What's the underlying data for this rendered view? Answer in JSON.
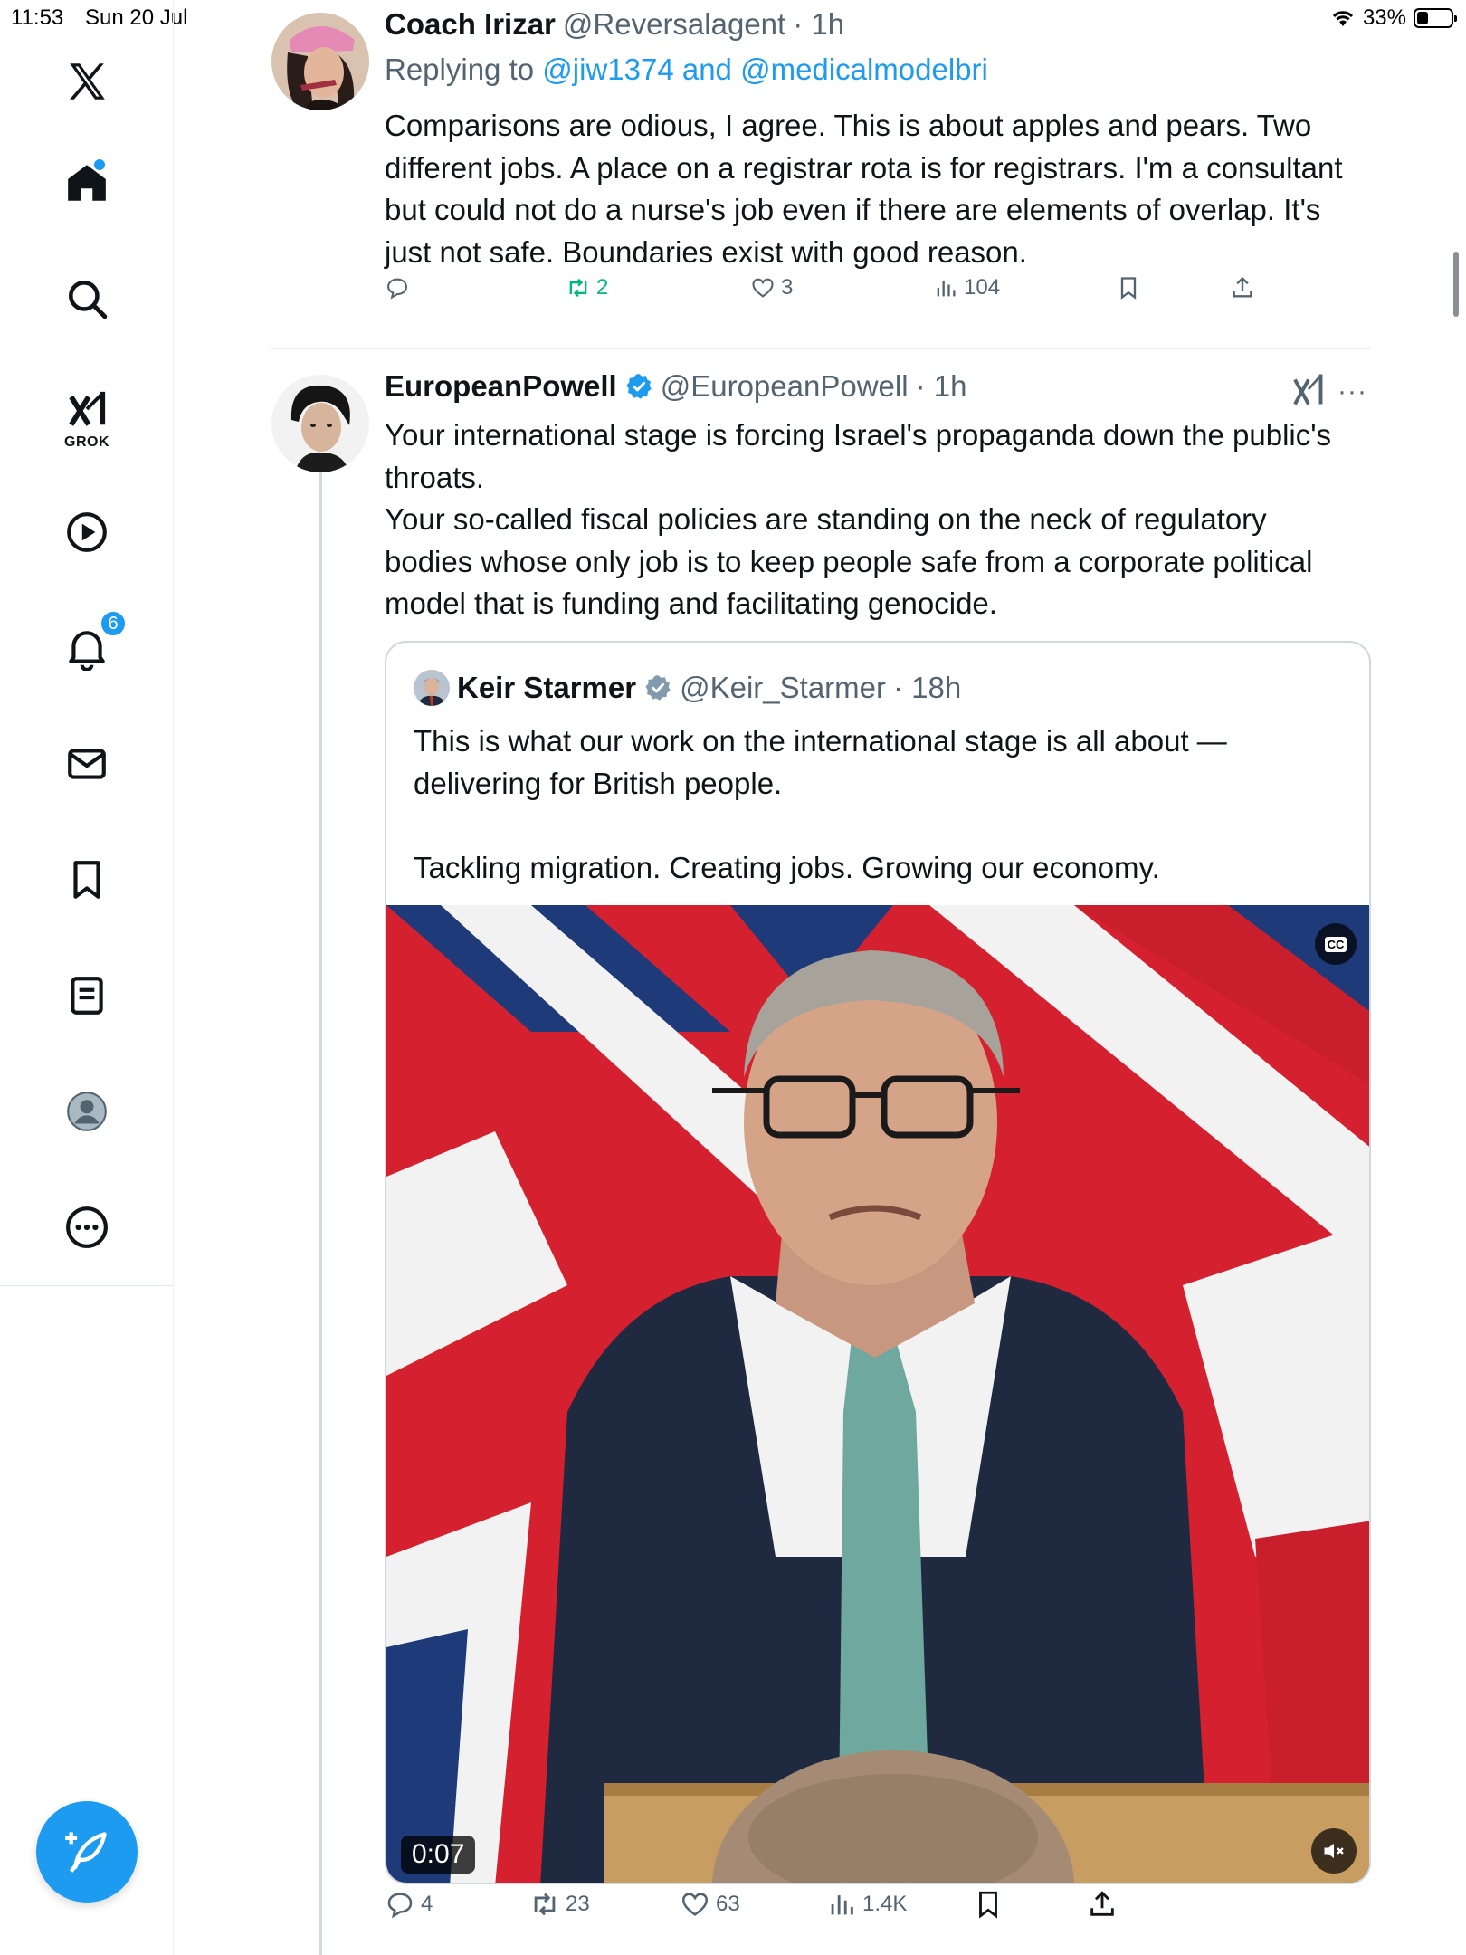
{
  "status_bar": {
    "time": "11:53",
    "date": "Sun 20 Jul",
    "battery": "33%",
    "battery_level": 0.33
  },
  "sidebar": {
    "items": [
      {
        "name": "x-logo",
        "icon": "x-logo-icon"
      },
      {
        "name": "home",
        "icon": "home-icon",
        "has_dot": true
      },
      {
        "name": "explore",
        "icon": "search-icon"
      },
      {
        "name": "grok",
        "icon": "grok-icon",
        "label": "GROK"
      },
      {
        "name": "video",
        "icon": "play-icon"
      },
      {
        "name": "notifications",
        "icon": "bell-icon",
        "badge": "6"
      },
      {
        "name": "messages",
        "icon": "mail-icon"
      },
      {
        "name": "bookmarks",
        "icon": "bookmark-icon"
      },
      {
        "name": "lists",
        "icon": "list-icon"
      },
      {
        "name": "profile",
        "icon": "avatar-icon"
      },
      {
        "name": "more",
        "icon": "more-icon"
      }
    ],
    "compose_icon": "compose-icon"
  },
  "tweet1": {
    "name": "Coach Irizar",
    "handle": "@Reversalagent",
    "time": "· 1h",
    "replying_prefix": "Replying to",
    "replying_to": "@jiw1374 and @medicalmodelbri",
    "text": "Comparisons are odious, I agree. This is about apples and pears. Two different jobs. A place on a registrar rota is for registrars. I'm a consultant but could not do a nurse's job even if there are elements of overlap. It's just not safe. Boundaries exist with good reason.",
    "replies": "",
    "retweets": "2",
    "likes": "3",
    "views": "104",
    "retweet_color": "#00ba7c"
  },
  "tweet2": {
    "name": "EuropeanPowell",
    "handle": "@EuropeanPowell",
    "time": "· 1h",
    "verified": true,
    "paragraphs": [
      "Your international stage is forcing Israel's propaganda down the public's throats.",
      "Your so-called fiscal policies are standing on the neck of regulatory bodies whose only job is to keep people safe from a corporate political model that is funding and facilitating genocide."
    ],
    "more_label": "···",
    "replies": "4",
    "retweets": "23",
    "likes": "63",
    "views": "1.4K",
    "quote": {
      "name": "Keir Starmer",
      "handle": "@Keir_Starmer",
      "time": "· 18h",
      "verified_color": "#829aab",
      "paragraphs": [
        "This is what our work on the international stage is all about — delivering for British people.",
        "",
        "Tackling migration. Creating jobs. Growing our economy."
      ],
      "video": {
        "duration": "0:07",
        "cc_label": "CC",
        "muted": true
      }
    }
  },
  "colors": {
    "accent": "#1d9bf0",
    "text": "#0f1419",
    "muted": "#536471",
    "border": "#cfd9de"
  }
}
